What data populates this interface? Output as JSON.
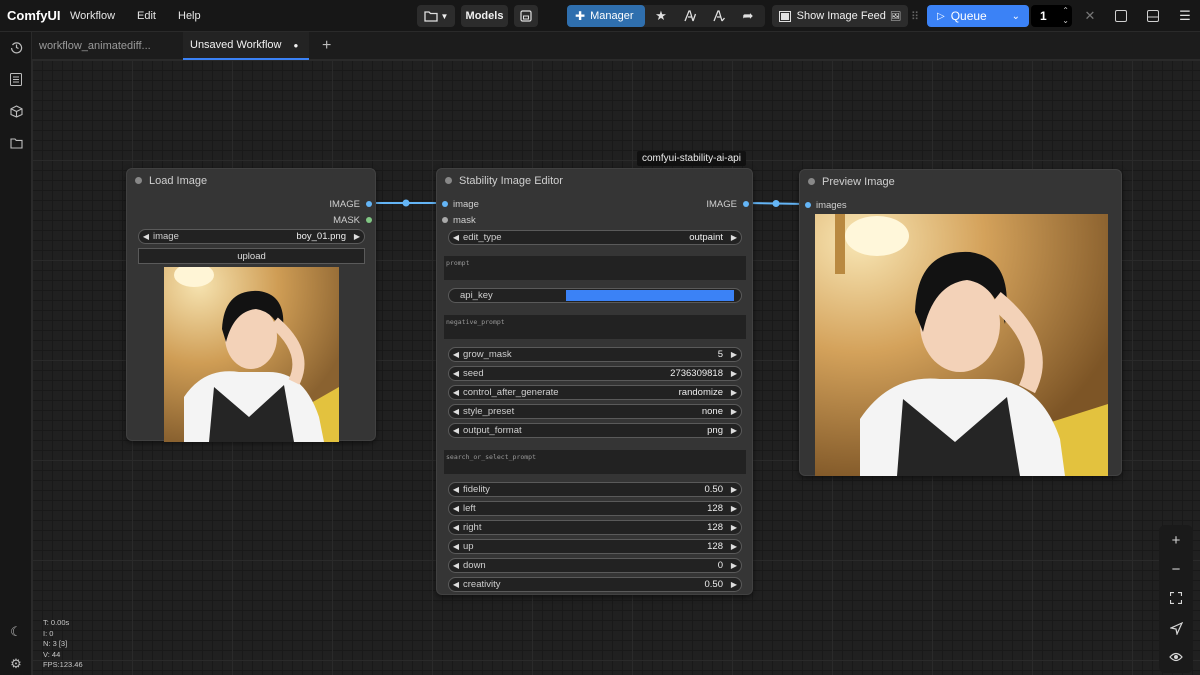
{
  "app": {
    "name": "ComfyUI"
  },
  "menu": [
    "Workflow",
    "Edit",
    "Help"
  ],
  "toolbar": {
    "models_label": "Models",
    "manager_label": "Manager",
    "image_feed_label": "Show Image Feed",
    "image_feed_emoji": "🖼",
    "queue_label": "Queue",
    "queue_count": "1"
  },
  "tabs": [
    {
      "label": "workflow_animatediff..."
    },
    {
      "label": "Unsaved Workflow",
      "modified": "●"
    }
  ],
  "add_tab": "+",
  "nodes": {
    "load_image": {
      "title": "Load Image",
      "outputs": [
        "IMAGE",
        "MASK"
      ],
      "image_label": "image",
      "image_value": "boy_01.png",
      "upload_label": "upload"
    },
    "stability": {
      "badge": "comfyui-stability-ai-api",
      "title": "Stability Image Editor",
      "inputs": [
        "image",
        "mask"
      ],
      "output": "IMAGE",
      "edit_type": {
        "label": "edit_type",
        "value": "outpaint"
      },
      "prompt_placeholder": "prompt",
      "api_key_label": "api_key",
      "negative_prompt_placeholder": "negative_prompt",
      "widgets": [
        {
          "label": "grow_mask",
          "value": "5"
        },
        {
          "label": "seed",
          "value": "2736309818"
        },
        {
          "label": "control_after_generate",
          "value": "randomize"
        },
        {
          "label": "style_preset",
          "value": "none"
        },
        {
          "label": "output_format",
          "value": "png"
        }
      ],
      "search_placeholder": "search_or_select_prompt",
      "widgets2": [
        {
          "label": "fidelity",
          "value": "0.50"
        },
        {
          "label": "left",
          "value": "128"
        },
        {
          "label": "right",
          "value": "128"
        },
        {
          "label": "up",
          "value": "128"
        },
        {
          "label": "down",
          "value": "0"
        },
        {
          "label": "creativity",
          "value": "0.50"
        }
      ]
    },
    "preview": {
      "title": "Preview Image",
      "input": "images"
    }
  },
  "stats": {
    "t": "T: 0.00s",
    "i": "I: 0",
    "n": "N: 3 [3]",
    "v": "V: 44",
    "fps": "FPS:123.46"
  },
  "colors": {
    "accent": "#3b82f6",
    "image_slot": "#64b5f6",
    "mask_slot": "#81c784",
    "link": "#64b5f6"
  },
  "icons": {
    "sidebar": [
      "history-icon",
      "queue-icon",
      "node-library-icon",
      "model-library-icon",
      "theme-icon",
      "settings-icon"
    ],
    "zoom": [
      "zoom-in-icon",
      "zoom-out-icon",
      "fit-view-icon",
      "locate-icon",
      "toggle-link-visibility-icon"
    ]
  }
}
